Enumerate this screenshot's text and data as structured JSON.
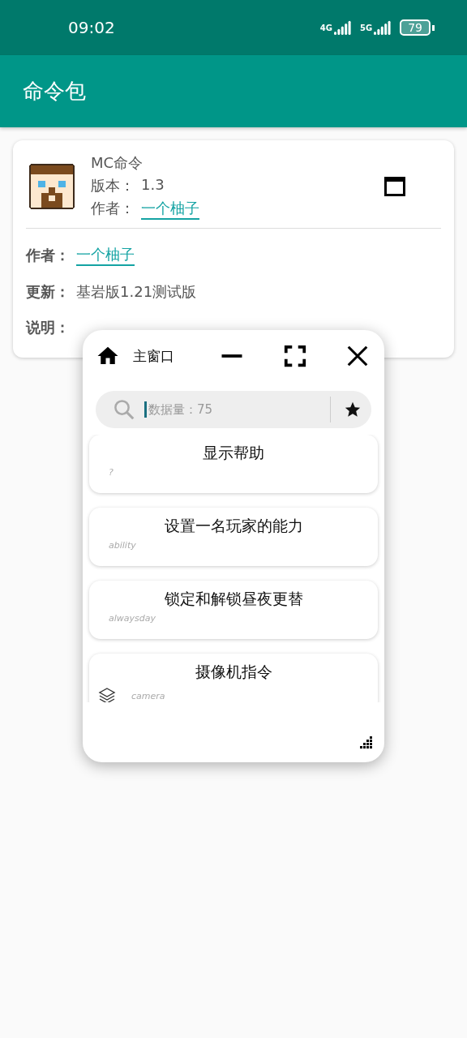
{
  "status_bar": {
    "time": "09:02",
    "signal_labels": [
      "4G",
      "5G"
    ],
    "battery": "79"
  },
  "app_bar": {
    "title": "命令包"
  },
  "pack_card": {
    "name": "MC命令",
    "version_label": "版本：",
    "version": "1.3",
    "author_label": "作者：",
    "author": "一个柚子",
    "details": [
      {
        "kind": "link",
        "label": "作者：",
        "value": "一个柚子"
      },
      {
        "kind": "text",
        "label": "更新：",
        "value": "基岩版1.21测试版"
      },
      {
        "kind": "note",
        "label": "说明："
      }
    ]
  },
  "floating_window": {
    "title": "主窗口",
    "search": {
      "placeholder": "数据量：75"
    },
    "commands": [
      {
        "title": "显示帮助",
        "name": "?",
        "icon": false
      },
      {
        "title": "设置一名玩家的能力",
        "name": "ability",
        "icon": false
      },
      {
        "title": "锁定和解锁昼夜更替",
        "name": "alwaysday",
        "icon": false
      },
      {
        "title": "摄像机指令",
        "name": "camera",
        "icon": true
      }
    ]
  }
}
